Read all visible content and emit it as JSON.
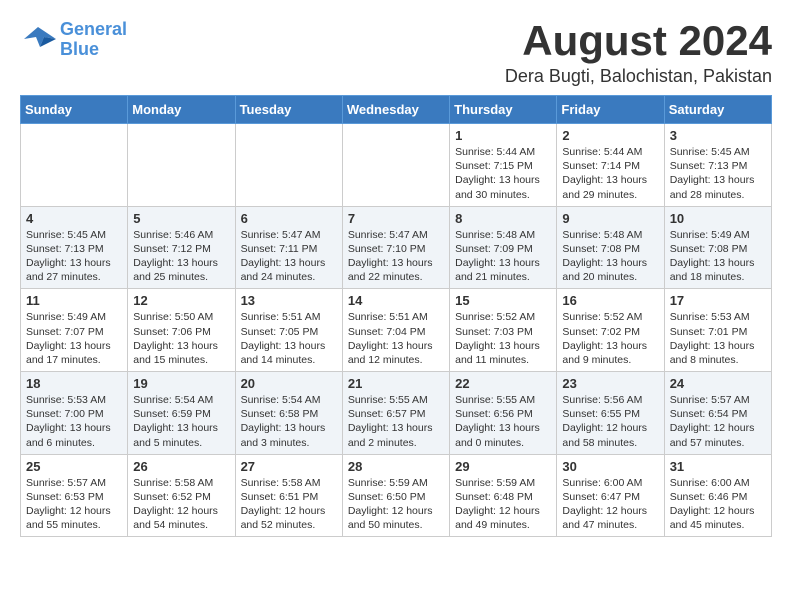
{
  "header": {
    "logo_line1": "General",
    "logo_line2": "Blue",
    "month": "August 2024",
    "location": "Dera Bugti, Balochistan, Pakistan"
  },
  "weekdays": [
    "Sunday",
    "Monday",
    "Tuesday",
    "Wednesday",
    "Thursday",
    "Friday",
    "Saturday"
  ],
  "weeks": [
    [
      {
        "day": "",
        "detail": ""
      },
      {
        "day": "",
        "detail": ""
      },
      {
        "day": "",
        "detail": ""
      },
      {
        "day": "",
        "detail": ""
      },
      {
        "day": "1",
        "detail": "Sunrise: 5:44 AM\nSunset: 7:15 PM\nDaylight: 13 hours\nand 30 minutes."
      },
      {
        "day": "2",
        "detail": "Sunrise: 5:44 AM\nSunset: 7:14 PM\nDaylight: 13 hours\nand 29 minutes."
      },
      {
        "day": "3",
        "detail": "Sunrise: 5:45 AM\nSunset: 7:13 PM\nDaylight: 13 hours\nand 28 minutes."
      }
    ],
    [
      {
        "day": "4",
        "detail": "Sunrise: 5:45 AM\nSunset: 7:13 PM\nDaylight: 13 hours\nand 27 minutes."
      },
      {
        "day": "5",
        "detail": "Sunrise: 5:46 AM\nSunset: 7:12 PM\nDaylight: 13 hours\nand 25 minutes."
      },
      {
        "day": "6",
        "detail": "Sunrise: 5:47 AM\nSunset: 7:11 PM\nDaylight: 13 hours\nand 24 minutes."
      },
      {
        "day": "7",
        "detail": "Sunrise: 5:47 AM\nSunset: 7:10 PM\nDaylight: 13 hours\nand 22 minutes."
      },
      {
        "day": "8",
        "detail": "Sunrise: 5:48 AM\nSunset: 7:09 PM\nDaylight: 13 hours\nand 21 minutes."
      },
      {
        "day": "9",
        "detail": "Sunrise: 5:48 AM\nSunset: 7:08 PM\nDaylight: 13 hours\nand 20 minutes."
      },
      {
        "day": "10",
        "detail": "Sunrise: 5:49 AM\nSunset: 7:08 PM\nDaylight: 13 hours\nand 18 minutes."
      }
    ],
    [
      {
        "day": "11",
        "detail": "Sunrise: 5:49 AM\nSunset: 7:07 PM\nDaylight: 13 hours\nand 17 minutes."
      },
      {
        "day": "12",
        "detail": "Sunrise: 5:50 AM\nSunset: 7:06 PM\nDaylight: 13 hours\nand 15 minutes."
      },
      {
        "day": "13",
        "detail": "Sunrise: 5:51 AM\nSunset: 7:05 PM\nDaylight: 13 hours\nand 14 minutes."
      },
      {
        "day": "14",
        "detail": "Sunrise: 5:51 AM\nSunset: 7:04 PM\nDaylight: 13 hours\nand 12 minutes."
      },
      {
        "day": "15",
        "detail": "Sunrise: 5:52 AM\nSunset: 7:03 PM\nDaylight: 13 hours\nand 11 minutes."
      },
      {
        "day": "16",
        "detail": "Sunrise: 5:52 AM\nSunset: 7:02 PM\nDaylight: 13 hours\nand 9 minutes."
      },
      {
        "day": "17",
        "detail": "Sunrise: 5:53 AM\nSunset: 7:01 PM\nDaylight: 13 hours\nand 8 minutes."
      }
    ],
    [
      {
        "day": "18",
        "detail": "Sunrise: 5:53 AM\nSunset: 7:00 PM\nDaylight: 13 hours\nand 6 minutes."
      },
      {
        "day": "19",
        "detail": "Sunrise: 5:54 AM\nSunset: 6:59 PM\nDaylight: 13 hours\nand 5 minutes."
      },
      {
        "day": "20",
        "detail": "Sunrise: 5:54 AM\nSunset: 6:58 PM\nDaylight: 13 hours\nand 3 minutes."
      },
      {
        "day": "21",
        "detail": "Sunrise: 5:55 AM\nSunset: 6:57 PM\nDaylight: 13 hours\nand 2 minutes."
      },
      {
        "day": "22",
        "detail": "Sunrise: 5:55 AM\nSunset: 6:56 PM\nDaylight: 13 hours\nand 0 minutes."
      },
      {
        "day": "23",
        "detail": "Sunrise: 5:56 AM\nSunset: 6:55 PM\nDaylight: 12 hours\nand 58 minutes."
      },
      {
        "day": "24",
        "detail": "Sunrise: 5:57 AM\nSunset: 6:54 PM\nDaylight: 12 hours\nand 57 minutes."
      }
    ],
    [
      {
        "day": "25",
        "detail": "Sunrise: 5:57 AM\nSunset: 6:53 PM\nDaylight: 12 hours\nand 55 minutes."
      },
      {
        "day": "26",
        "detail": "Sunrise: 5:58 AM\nSunset: 6:52 PM\nDaylight: 12 hours\nand 54 minutes."
      },
      {
        "day": "27",
        "detail": "Sunrise: 5:58 AM\nSunset: 6:51 PM\nDaylight: 12 hours\nand 52 minutes."
      },
      {
        "day": "28",
        "detail": "Sunrise: 5:59 AM\nSunset: 6:50 PM\nDaylight: 12 hours\nand 50 minutes."
      },
      {
        "day": "29",
        "detail": "Sunrise: 5:59 AM\nSunset: 6:48 PM\nDaylight: 12 hours\nand 49 minutes."
      },
      {
        "day": "30",
        "detail": "Sunrise: 6:00 AM\nSunset: 6:47 PM\nDaylight: 12 hours\nand 47 minutes."
      },
      {
        "day": "31",
        "detail": "Sunrise: 6:00 AM\nSunset: 6:46 PM\nDaylight: 12 hours\nand 45 minutes."
      }
    ]
  ]
}
